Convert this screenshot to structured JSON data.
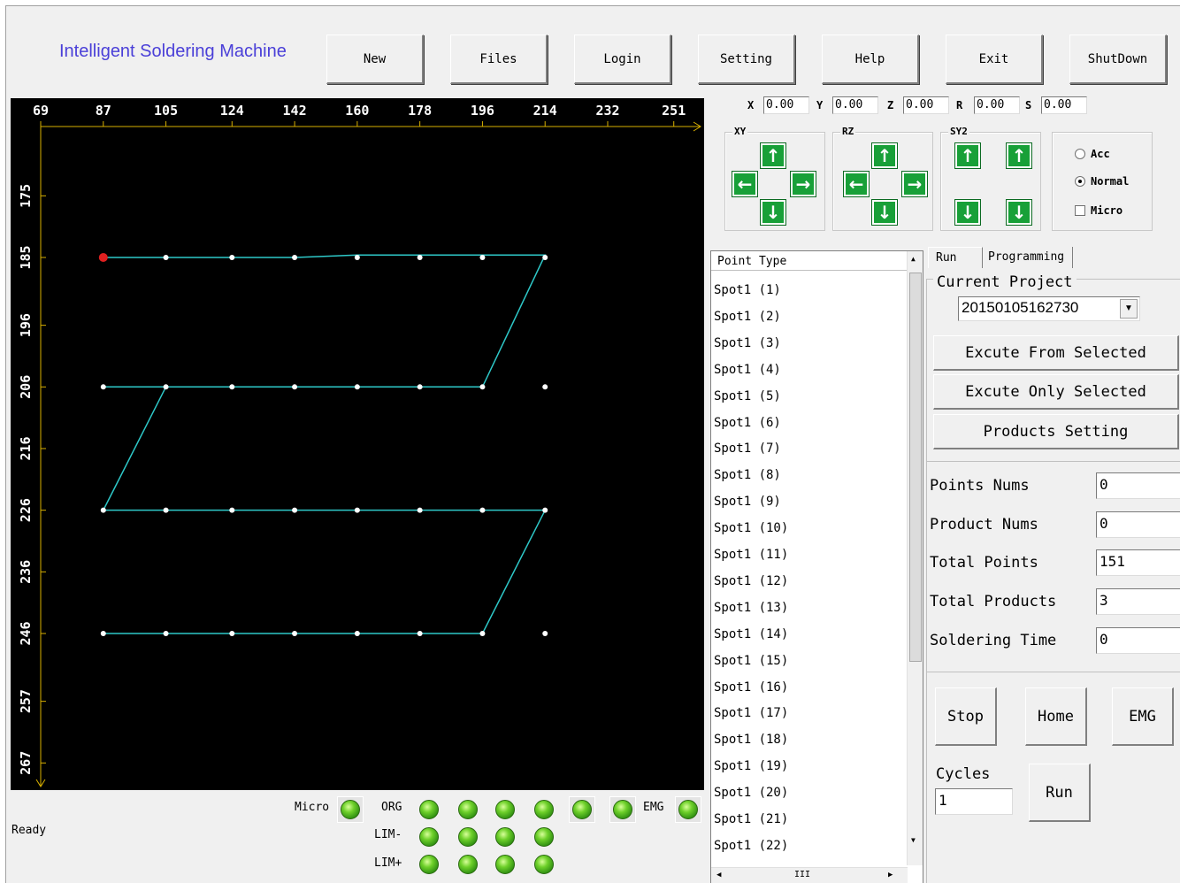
{
  "app": {
    "title": "Intelligent Soldering Machine"
  },
  "toolbar": [
    "New",
    "Files",
    "Login",
    "Setting",
    "Help",
    "Exit",
    "ShutDown"
  ],
  "canvas": {
    "x_ticks": [
      "69",
      "87",
      "105",
      "124",
      "142",
      "160",
      "178",
      "196",
      "214",
      "232",
      "251"
    ],
    "y_ticks": [
      "175",
      "185",
      "196",
      "206",
      "216",
      "226",
      "236",
      "246",
      "257",
      "267"
    ],
    "path_points": [
      [
        87,
        185
      ],
      [
        105,
        185
      ],
      [
        124,
        185
      ],
      [
        142,
        185
      ],
      [
        160,
        184.6
      ],
      [
        178,
        184.6
      ],
      [
        196,
        184.6
      ],
      [
        214,
        184.6
      ],
      [
        196,
        206
      ],
      [
        178,
        206
      ],
      [
        160,
        206
      ],
      [
        142,
        206
      ],
      [
        124,
        206
      ],
      [
        105,
        206
      ],
      [
        87,
        206
      ],
      [
        105,
        206
      ],
      [
        87,
        226
      ],
      [
        105,
        226
      ],
      [
        124,
        226
      ],
      [
        142,
        226
      ],
      [
        160,
        226
      ],
      [
        178,
        226
      ],
      [
        196,
        226
      ],
      [
        214,
        226
      ],
      [
        196,
        246
      ],
      [
        178,
        246
      ],
      [
        160,
        246
      ],
      [
        142,
        246
      ],
      [
        124,
        246
      ],
      [
        105,
        246
      ],
      [
        87,
        246
      ]
    ],
    "rows": [
      {
        "y": 185,
        "xs": [
          87,
          105,
          124,
          142,
          160,
          178,
          196,
          214
        ]
      },
      {
        "y": 206,
        "xs": [
          87,
          105,
          124,
          142,
          160,
          178,
          196,
          214
        ]
      },
      {
        "y": 226,
        "xs": [
          87,
          105,
          124,
          142,
          160,
          178,
          196,
          214
        ]
      },
      {
        "y": 246,
        "xs": [
          87,
          105,
          124,
          142,
          160,
          178,
          196,
          214
        ]
      }
    ],
    "start_point": [
      87,
      185
    ],
    "colors": {
      "background": "#000000",
      "path": "#2ec8c8",
      "point": "#ffffff",
      "start": "#e02020",
      "axis": "#d8b000"
    }
  },
  "coords": [
    {
      "label": "X",
      "value": "0.00"
    },
    {
      "label": "Y",
      "value": "0.00"
    },
    {
      "label": "Z",
      "value": "0.00"
    },
    {
      "label": "R",
      "value": "0.00"
    },
    {
      "label": "S",
      "value": "0.00"
    }
  ],
  "jog_groups": [
    "XY",
    "RZ",
    "SY2"
  ],
  "speed_modes": {
    "acc": "Acc",
    "normal": "Normal",
    "micro": "Micro"
  },
  "list": {
    "header": "Point Type",
    "items": [
      "Spot1 (1)",
      "Spot1 (2)",
      "Spot1 (3)",
      "Spot1 (4)",
      "Spot1 (5)",
      "Spot1 (6)",
      "Spot1 (7)",
      "Spot1 (8)",
      "Spot1 (9)",
      "Spot1 (10)",
      "Spot1 (11)",
      "Spot1 (12)",
      "Spot1 (13)",
      "Spot1 (14)",
      "Spot1 (15)",
      "Spot1 (16)",
      "Spot1 (17)",
      "Spot1 (18)",
      "Spot1 (19)",
      "Spot1 (20)",
      "Spot1 (21)",
      "Spot1 (22)"
    ],
    "hscroll_grip": "III"
  },
  "tabs": {
    "run": "Run",
    "programming": "Programming"
  },
  "project": {
    "label": "Current Project",
    "value": "20150105162730"
  },
  "actions": {
    "excute_from": "Excute From Selected",
    "excute_only": "Excute Only Selected",
    "products_setting": "Products Setting"
  },
  "stats": [
    {
      "label": "Points Nums",
      "value": "0"
    },
    {
      "label": "Product Nums",
      "value": "0"
    },
    {
      "label": "Total Points",
      "value": "151"
    },
    {
      "label": "Total Products",
      "value": "3"
    },
    {
      "label": "Soldering Time",
      "value": "0"
    }
  ],
  "controls": {
    "stop": "Stop",
    "home": "Home",
    "emg": "EMG",
    "cycles_label": "Cycles",
    "cycles_value": "1",
    "run": "Run"
  },
  "status": {
    "ready": "Ready",
    "micro_label": "Micro",
    "org_label": "ORG",
    "lim_minus_label": "LIM-",
    "lim_plus_label": "LIM+",
    "emg_label": "EMG"
  }
}
